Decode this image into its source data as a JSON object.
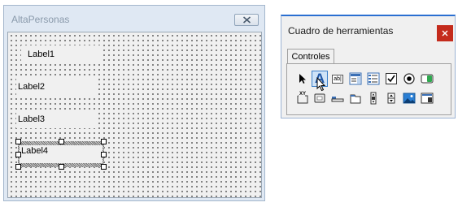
{
  "form": {
    "title": "AltaPersonas",
    "labels": [
      "Label1",
      "Label2",
      "Label3",
      "Label4"
    ]
  },
  "toolbox": {
    "title": "Cuadro de herramientas",
    "tab": "Controles",
    "textbox_glyph": "ab|",
    "glyph_a": "A",
    "glyph_xy": "XY",
    "tools": [
      "pointer-icon",
      "label-tool-icon",
      "textbox-tool-icon",
      "combobox-tool-icon",
      "listbox-tool-icon",
      "checkbox-tool-icon",
      "optionbutton-tool-icon",
      "togglebutton-tool-icon",
      "frame-tool-icon",
      "commandbutton-tool-icon",
      "tabstrip-tool-icon",
      "multipage-tool-icon",
      "scrollbar-tool-icon",
      "spinbutton-tool-icon",
      "image-tool-icon",
      "refedit-tool-icon"
    ]
  },
  "colors": {
    "accent": "#2a6fd1",
    "close_red": "#c42b1c",
    "selected_tool": "#cfe3f7"
  }
}
